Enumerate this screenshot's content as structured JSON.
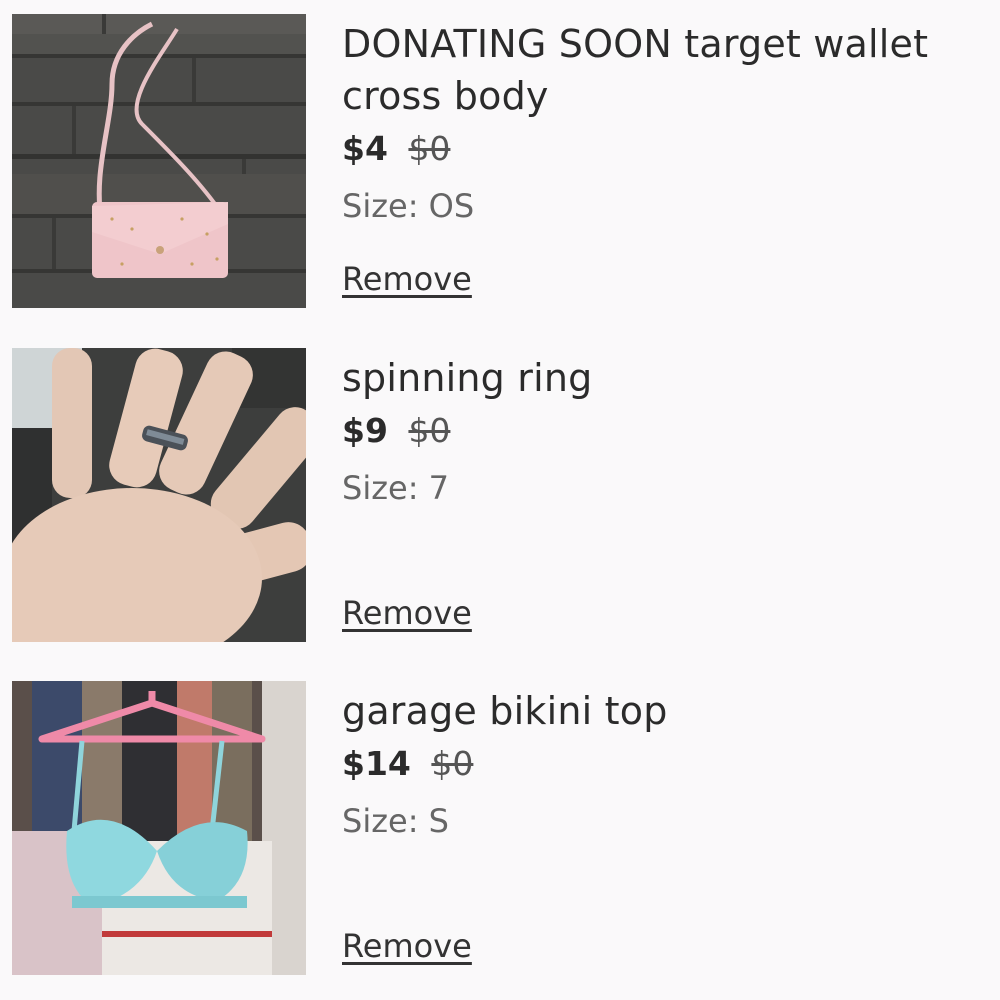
{
  "items": [
    {
      "title": "DONATING SOON target wallet cross body",
      "price": "$4",
      "original_price": "$0",
      "size_label": "Size:",
      "size": "OS",
      "remove_label": "Remove",
      "image_alt": "pink-wallet-photo"
    },
    {
      "title": "spinning ring",
      "price": "$9",
      "original_price": "$0",
      "size_label": "Size:",
      "size": "7",
      "remove_label": "Remove",
      "image_alt": "ring-on-hand-photo"
    },
    {
      "title": "garage bikini top",
      "price": "$14",
      "original_price": "$0",
      "size_label": "Size:",
      "size": "S",
      "remove_label": "Remove",
      "image_alt": "bikini-top-on-hanger-photo"
    }
  ],
  "colors": {
    "background": "#faf9fa",
    "text": "#2b2b2b",
    "muted": "#666666"
  }
}
